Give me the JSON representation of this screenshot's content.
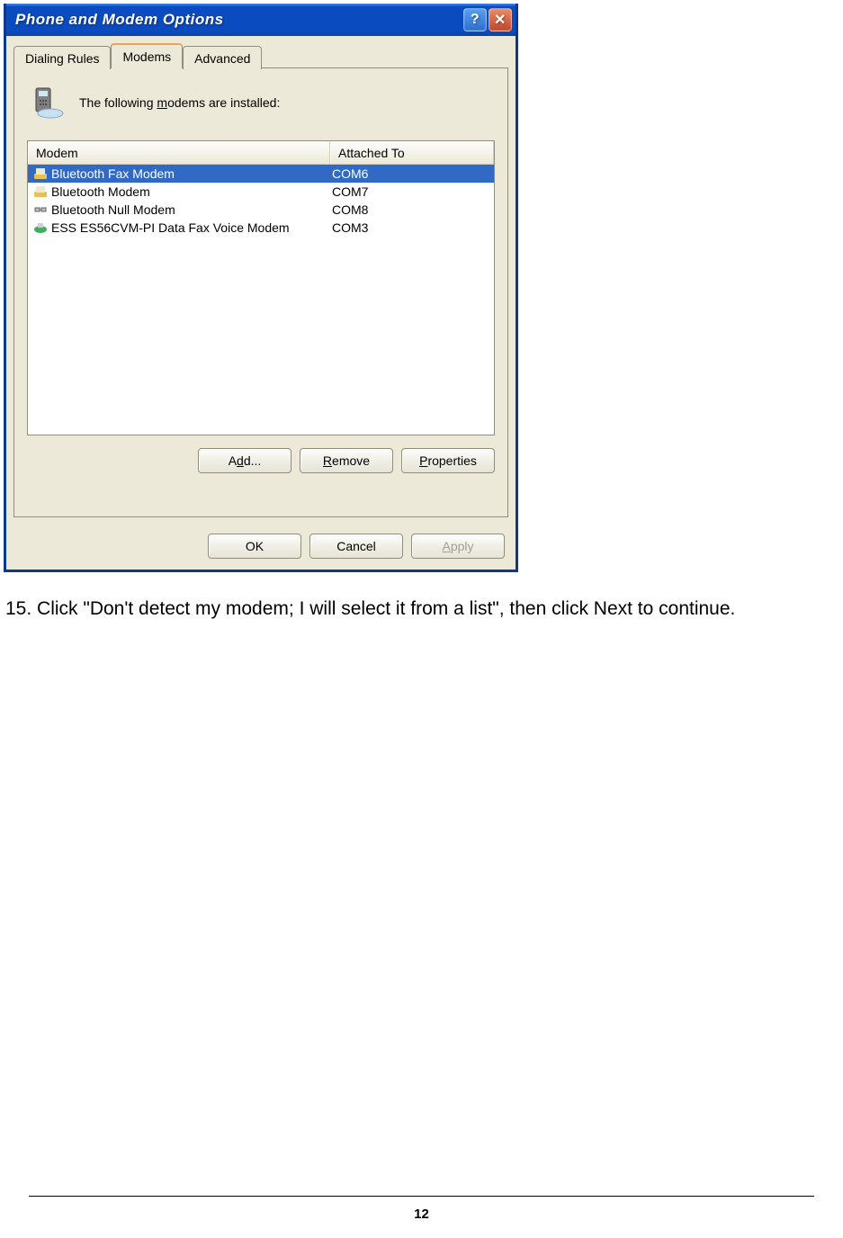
{
  "dialog": {
    "title": "Phone and Modem Options",
    "tabs": [
      "Dialing Rules",
      "Modems",
      "Advanced"
    ],
    "active_tab": 1,
    "info_text_prefix": "The following ",
    "info_text_m": "m",
    "info_text_suffix": "odems are  installed:",
    "columns": {
      "modem": "Modem",
      "attached": "Attached To"
    },
    "rows": [
      {
        "name": "Bluetooth Fax Modem",
        "port": "COM6",
        "icon": "modem-fax",
        "selected": true
      },
      {
        "name": "Bluetooth Modem",
        "port": "COM7",
        "icon": "modem-bt",
        "selected": false
      },
      {
        "name": "Bluetooth Null Modem",
        "port": "COM8",
        "icon": "modem-null",
        "selected": false
      },
      {
        "name": "ESS ES56CVM-PI Data Fax Voice Modem",
        "port": "COM3",
        "icon": "modem-green",
        "selected": false
      }
    ],
    "inner_buttons": {
      "add": {
        "prefix": "A",
        "u": "d",
        "suffix": "d..."
      },
      "remove": {
        "prefix": "",
        "u": "R",
        "suffix": "emove"
      },
      "properties": {
        "prefix": "",
        "u": "P",
        "suffix": "roperties"
      }
    },
    "footer_buttons": {
      "ok": "OK",
      "cancel": "Cancel",
      "apply": {
        "prefix": "",
        "u": "A",
        "suffix": "pply"
      }
    }
  },
  "instruction": "15. Click \"Don't detect my modem; I will select it from a list\", then click Next to continue.",
  "page_number": "12"
}
